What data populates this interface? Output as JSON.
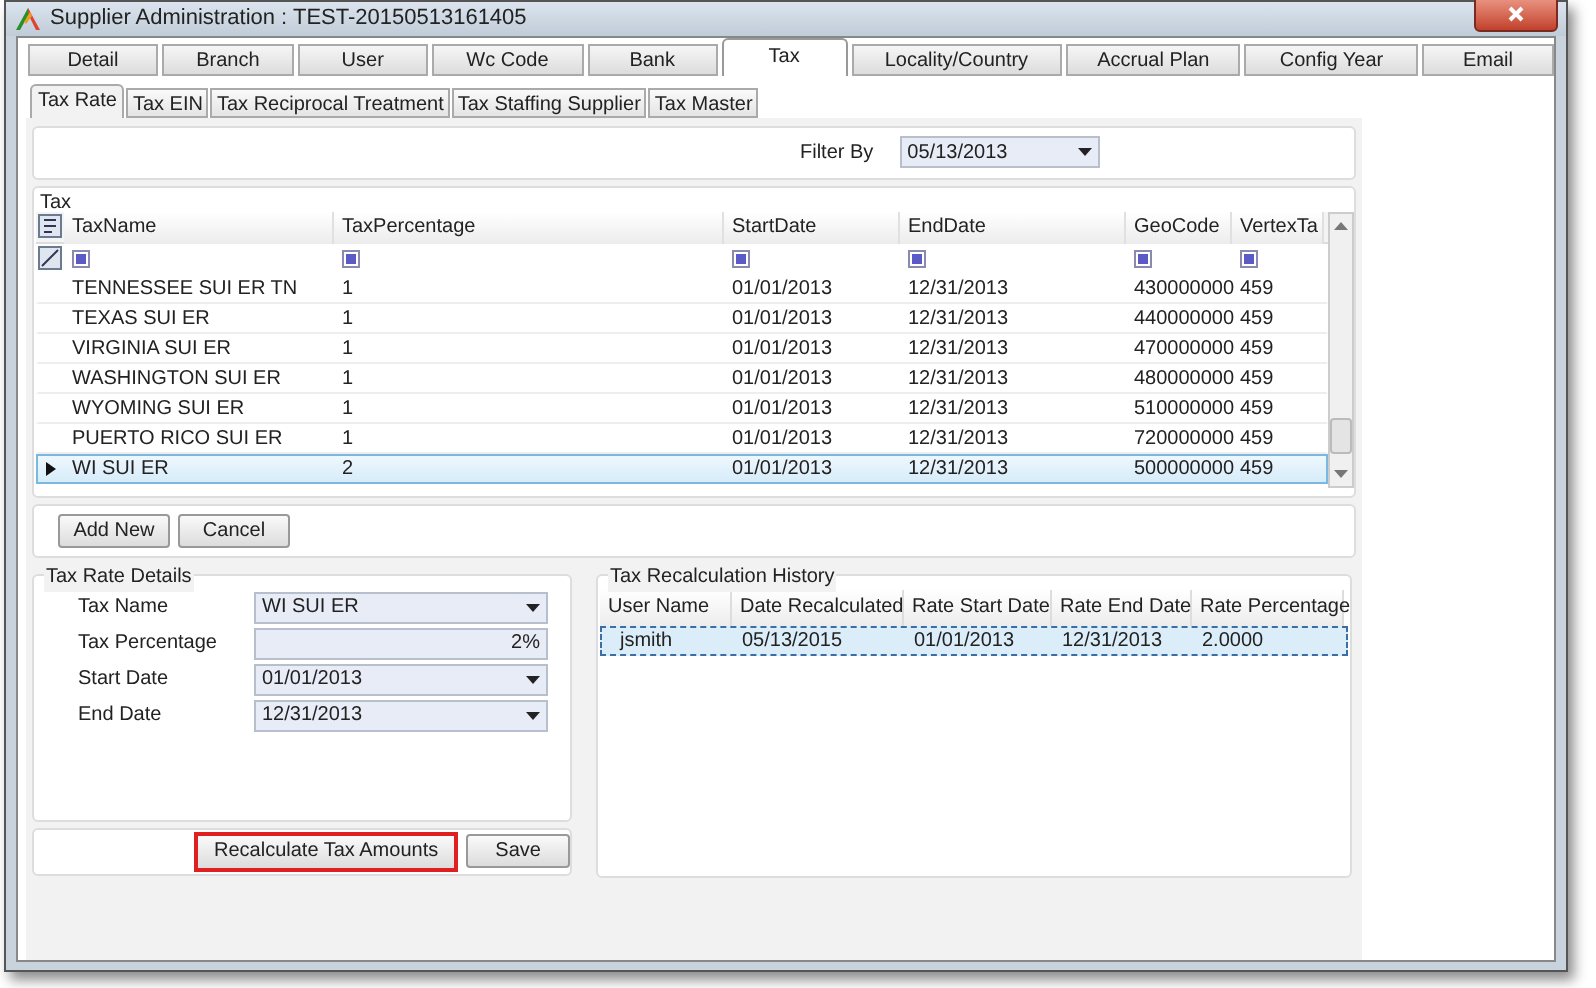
{
  "window": {
    "title": "Supplier Administration : TEST-20150513161405"
  },
  "tabs": [
    {
      "label": "Detail",
      "selected": false
    },
    {
      "label": "Branch",
      "selected": false
    },
    {
      "label": "User",
      "selected": false
    },
    {
      "label": "Wc Code",
      "selected": false
    },
    {
      "label": "Bank",
      "selected": false
    },
    {
      "label": "Tax",
      "selected": true
    },
    {
      "label": "Locality/Country",
      "selected": false
    },
    {
      "label": "Accrual Plan",
      "selected": false
    },
    {
      "label": "Config Year",
      "selected": false
    },
    {
      "label": "Email",
      "selected": false
    }
  ],
  "subtabs": [
    {
      "label": "Tax Rate",
      "selected": true
    },
    {
      "label": "Tax EIN",
      "selected": false
    },
    {
      "label": "Tax Reciprocal Treatment",
      "selected": false
    },
    {
      "label": "Tax Staffing Supplier",
      "selected": false
    },
    {
      "label": "Tax Master",
      "selected": false
    }
  ],
  "filter": {
    "label": "Filter By",
    "value": "05/13/2013"
  },
  "tax_grid": {
    "title": "Tax",
    "columns": [
      "TaxName",
      "TaxPercentage",
      "StartDate",
      "EndDate",
      "GeoCode",
      "VertexTa"
    ],
    "rows": [
      {
        "cells": [
          "TENNESSEE SUI ER TN",
          "1",
          "01/01/2013",
          "12/31/2013",
          "430000000",
          "459"
        ],
        "selected": false
      },
      {
        "cells": [
          "TEXAS SUI ER",
          "1",
          "01/01/2013",
          "12/31/2013",
          "440000000",
          "459"
        ],
        "selected": false
      },
      {
        "cells": [
          "VIRGINIA SUI ER",
          "1",
          "01/01/2013",
          "12/31/2013",
          "470000000",
          "459"
        ],
        "selected": false
      },
      {
        "cells": [
          "WASHINGTON SUI ER",
          "1",
          "01/01/2013",
          "12/31/2013",
          "480000000",
          "459"
        ],
        "selected": false
      },
      {
        "cells": [
          "WYOMING SUI ER",
          "1",
          "01/01/2013",
          "12/31/2013",
          "510000000",
          "459"
        ],
        "selected": false
      },
      {
        "cells": [
          "PUERTO RICO SUI ER",
          "1",
          "01/01/2013",
          "12/31/2013",
          "720000000",
          "459"
        ],
        "selected": false
      },
      {
        "cells": [
          "WI SUI ER",
          "2",
          "01/01/2013",
          "12/31/2013",
          "500000000",
          "459"
        ],
        "selected": true
      }
    ]
  },
  "grid_buttons": [
    "Add New",
    "Cancel"
  ],
  "details": {
    "title": "Tax Rate Details",
    "fields": [
      {
        "label": "Tax Name",
        "value": "WI SUI ER",
        "kind": "dropdown"
      },
      {
        "label": "Tax Percentage",
        "value": "2%",
        "kind": "text"
      },
      {
        "label": "Start Date",
        "value": "01/01/2013",
        "kind": "dropdown"
      },
      {
        "label": "End Date",
        "value": "12/31/2013",
        "kind": "dropdown"
      }
    ]
  },
  "actions": [
    {
      "label": "Recalculate Tax Amounts",
      "highlighted": true
    },
    {
      "label": "Save",
      "highlighted": false
    }
  ],
  "history": {
    "title": "Tax Recalculation History",
    "columns": [
      "User Name",
      "Date Recalculated",
      "Rate Start Date",
      "Rate End Date",
      "Rate Percentage"
    ],
    "rows": [
      {
        "cells": [
          "jsmith",
          "05/13/2015",
          "01/01/2013",
          "12/31/2013",
          "2.0000"
        ],
        "selected": true
      }
    ]
  }
}
